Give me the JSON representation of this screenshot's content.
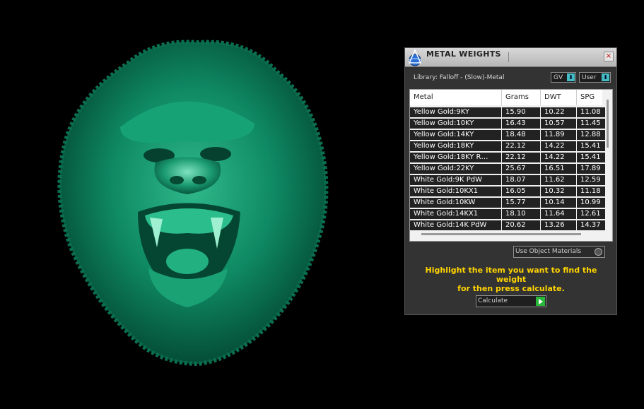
{
  "panel": {
    "title": "METAL WEIGHTS",
    "close_glyph": "×",
    "library_label": "Library: Falloff - (Slow)-Metal",
    "unit_dropdown": "GV",
    "user_dropdown": "User",
    "dropdown_arrow": "⬇",
    "columns": [
      "Metal",
      "Grams",
      "DWT",
      "SPG"
    ],
    "rows": [
      {
        "metal": "Yellow Gold:9KY",
        "grams": "15.90",
        "dwt": "10.22",
        "spg": "11.08"
      },
      {
        "metal": "Yellow Gold:10KY",
        "grams": "16.43",
        "dwt": "10.57",
        "spg": "11.45"
      },
      {
        "metal": "Yellow Gold:14KY",
        "grams": "18.48",
        "dwt": "11.89",
        "spg": "12.88"
      },
      {
        "metal": "Yellow Gold:18KY",
        "grams": "22.12",
        "dwt": "14.22",
        "spg": "15.41"
      },
      {
        "metal": "Yellow Gold:18KY R…",
        "grams": "22.12",
        "dwt": "14.22",
        "spg": "15.41"
      },
      {
        "metal": "Yellow Gold:22KY",
        "grams": "25.67",
        "dwt": "16.51",
        "spg": "17.89"
      },
      {
        "metal": "White Gold:9K PdW",
        "grams": "18.07",
        "dwt": "11.62",
        "spg": "12.59"
      },
      {
        "metal": "White Gold:10KX1",
        "grams": "16.05",
        "dwt": "10.32",
        "spg": "11.18"
      },
      {
        "metal": "White Gold:10KW",
        "grams": "15.77",
        "dwt": "10.14",
        "spg": "10.99"
      },
      {
        "metal": "White Gold:14KX1",
        "grams": "18.10",
        "dwt": "11.64",
        "spg": "12.61"
      },
      {
        "metal": "White Gold:14K PdW",
        "grams": "20.62",
        "dwt": "13.26",
        "spg": "14.37"
      }
    ],
    "use_object_materials": "Use Object Materials",
    "hint_line1": "Highlight the item you want to find the weight",
    "hint_line2": "for then press calculate.",
    "calculate_label": "Calculate"
  },
  "colors": {
    "model_green": "#0d8a62",
    "hint_yellow": "#ffd400",
    "dropdown_accent": "#43bcc4",
    "go_green": "#27b83a"
  },
  "icons": {
    "app_icon": "gemvision-icon",
    "calc_icon": "play-arrow-icon"
  }
}
